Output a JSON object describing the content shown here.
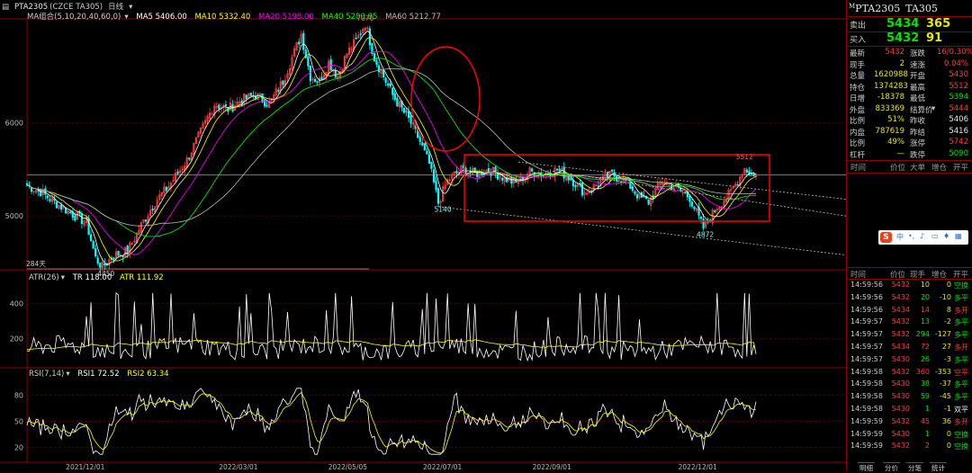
{
  "header": {
    "menu_icon": "menu-icon",
    "contract": "PTA2305",
    "exchange": "(CZCE TA305)",
    "period": "日线",
    "ma_title": "MA组合(5,10,20,40,60,0)",
    "ma5": "MA5 5406.00",
    "ma10": "MA10 5332.40",
    "ma20": "MA20 5198.00",
    "ma40": "MA40 5200.85",
    "ma60": "MA60 5212.77"
  },
  "colors": {
    "up": "#ff3c3c",
    "down": "#00ffff",
    "ma5": "#ffffff",
    "ma10": "#ffff00",
    "ma20": "#ff00ff",
    "ma40": "#00ff00",
    "ma60": "#bbbbbb",
    "annotation": "#ff0000"
  },
  "chart_data": [
    {
      "type": "candlestick",
      "name": "main",
      "y_ticks": [
        6000,
        5000
      ],
      "ylim": [
        4450,
        7070
      ],
      "labels": {
        "high": "7070",
        "low": "4450",
        "range_low": "5140",
        "range_high": "5512",
        "recent_low": "4872",
        "note": "284天"
      },
      "x_ticks": [
        "2021/12/01",
        "2022/03/01",
        "2022/05/05",
        "2022/07/01",
        "2022/09/01",
        "2022/12/01"
      ],
      "price_path": [
        [
          0,
          5330
        ],
        [
          6,
          5260
        ],
        [
          12,
          5150
        ],
        [
          20,
          5020
        ],
        [
          26,
          4930
        ],
        [
          30,
          4550
        ],
        [
          33,
          4450
        ],
        [
          38,
          4580
        ],
        [
          44,
          4620
        ],
        [
          50,
          4900
        ],
        [
          56,
          5150
        ],
        [
          62,
          5320
        ],
        [
          70,
          5600
        ],
        [
          76,
          5900
        ],
        [
          82,
          6200
        ],
        [
          88,
          6150
        ],
        [
          94,
          6250
        ],
        [
          100,
          6300
        ],
        [
          106,
          6200
        ],
        [
          112,
          6450
        ],
        [
          116,
          6700
        ],
        [
          120,
          6950
        ],
        [
          124,
          6500
        ],
        [
          128,
          6450
        ],
        [
          132,
          6650
        ],
        [
          136,
          6500
        ],
        [
          140,
          6750
        ],
        [
          144,
          6880
        ],
        [
          148,
          7070
        ],
        [
          152,
          6700
        ],
        [
          156,
          6500
        ],
        [
          160,
          6300
        ],
        [
          164,
          6150
        ],
        [
          168,
          6000
        ],
        [
          172,
          5800
        ],
        [
          176,
          5560
        ],
        [
          180,
          5140
        ],
        [
          184,
          5380
        ],
        [
          190,
          5500
        ],
        [
          196,
          5450
        ],
        [
          202,
          5500
        ],
        [
          208,
          5420
        ],
        [
          214,
          5350
        ],
        [
          220,
          5480
        ],
        [
          226,
          5450
        ],
        [
          232,
          5500
        ],
        [
          238,
          5400
        ],
        [
          244,
          5250
        ],
        [
          250,
          5350
        ],
        [
          256,
          5450
        ],
        [
          262,
          5380
        ],
        [
          268,
          5200
        ],
        [
          272,
          5150
        ],
        [
          278,
          5380
        ],
        [
          284,
          5300
        ],
        [
          290,
          5200
        ],
        [
          296,
          4872
        ],
        [
          302,
          5100
        ],
        [
          308,
          5250
        ],
        [
          314,
          5512
        ],
        [
          318,
          5432
        ]
      ],
      "total_bars": 320
    },
    {
      "type": "line",
      "name": "ATR",
      "params": "ATR(26)",
      "series": [
        {
          "name": "TR",
          "last": 118.0
        },
        {
          "name": "ATR",
          "last": 111.92
        }
      ],
      "y_ticks": [
        400,
        200
      ]
    },
    {
      "type": "line",
      "name": "RSI",
      "params": "RSI(7,14)",
      "series": [
        {
          "name": "RSI1",
          "last": 72.52
        },
        {
          "name": "RSI2",
          "last": 63.34
        }
      ],
      "y_ticks": [
        80,
        50,
        20
      ]
    }
  ],
  "indicators": {
    "atr_title": "ATR(26)",
    "atr_tr": "TR 118.00",
    "atr_atr": "ATR 111.92",
    "rsi_title": "RSI(7,14)",
    "rsi1": "RSI1 72.52",
    "rsi2": "RSI2 63.34"
  },
  "axis": {
    "y_main": [
      "6000",
      "5000"
    ],
    "y_atr": [
      "400",
      "200"
    ],
    "y_rsi": [
      "80",
      "50",
      "20"
    ],
    "x": [
      "2021/12/01",
      "2022/03/01",
      "2022/05/05",
      "2022/07/01",
      "2022/09/01",
      "2022/12/01"
    ]
  },
  "panel": {
    "code": "PTA2305",
    "exchange_code": "TA305",
    "sell_label": "卖出",
    "sell_price": "5434",
    "sell_vol": "365",
    "buy_label": "买入",
    "buy_price": "5432",
    "buy_vol": "91",
    "quote": [
      {
        "l1": "最新",
        "v1": "5432",
        "c1": "#ff3c3c",
        "l2": "涨跌",
        "v2": "16/0.30%",
        "c2": "#ff3c3c"
      },
      {
        "l1": "现手",
        "v1": "2",
        "c1": "#e8e800",
        "l2": "速涨",
        "v2": "0.04%",
        "c2": "#ff3c3c"
      },
      {
        "l1": "总量",
        "v1": "1620988",
        "c1": "#e8e800",
        "l2": "开盘",
        "v2": "5430",
        "c2": "#ff3c3c"
      },
      {
        "l1": "持仓",
        "v1": "1374283",
        "c1": "#e8e800",
        "l2": "最高",
        "v2": "5512",
        "c2": "#ff3c3c"
      },
      {
        "l1": "日增",
        "v1": "-18378",
        "c1": "#e8e800",
        "l2": "最低",
        "v2": "5394",
        "c2": "#00e400"
      },
      {
        "l1": "外盘",
        "v1": "833369",
        "c1": "#e8e800",
        "l2": "结算价",
        "v2": "5444",
        "c2": "#ff3c3c"
      },
      {
        "l1": "比例",
        "v1": "51%",
        "c1": "#e8e800",
        "l2": "昨收",
        "v2": "5406",
        "c2": "#e8e8e8"
      },
      {
        "l1": "内盘",
        "v1": "787619",
        "c1": "#e8e800",
        "l2": "昨结",
        "v2": "5416",
        "c2": "#e8e8e8"
      },
      {
        "l1": "比例",
        "v1": "49%",
        "c1": "#e8e800",
        "l2": "涨停",
        "v2": "5742",
        "c2": "#ff3c3c"
      },
      {
        "l1": "杠杆",
        "v1": "—",
        "c1": "#e8e800",
        "l2": "跌停",
        "v2": "5090",
        "c2": "#00e400"
      }
    ],
    "col_headers_1": [
      "时间",
      "价位",
      "大单",
      "增仓",
      "开平"
    ],
    "col_headers_2": [
      "时间",
      "价位",
      "现手",
      "增仓",
      "开平"
    ],
    "ticks": [
      {
        "time": "14:59:56",
        "price": "5432",
        "vol": "10",
        "oi": "0",
        "nature": "空换",
        "vc": "#e8e800",
        "oc": "#e8e800",
        "nc": "#00e400"
      },
      {
        "time": "14:59:56",
        "price": "5432",
        "vol": "20",
        "oi": "-10",
        "nature": "多平",
        "vc": "#00e400",
        "oc": "#e8e800",
        "nc": "#00e400"
      },
      {
        "time": "14:59:56",
        "price": "5434",
        "vol": "14",
        "oi": "8",
        "nature": "多开",
        "vc": "#ff3c3c",
        "oc": "#e8e800",
        "nc": "#ff3c3c"
      },
      {
        "time": "14:59:57",
        "price": "5432",
        "vol": "13",
        "oi": "-2",
        "nature": "多平",
        "vc": "#00e400",
        "oc": "#e8e800",
        "nc": "#00e400"
      },
      {
        "time": "14:59:57",
        "price": "5432",
        "vol": "294",
        "oi": "-127",
        "nature": "多平",
        "vc": "#00e400",
        "oc": "#e8e800",
        "nc": "#00e400"
      },
      {
        "time": "14:59:57",
        "price": "5434",
        "vol": "72",
        "oi": "27",
        "nature": "多开",
        "vc": "#ff3c3c",
        "oc": "#e8e800",
        "nc": "#ff3c3c"
      },
      {
        "time": "14:59:57",
        "price": "5430",
        "vol": "26",
        "oi": "-3",
        "nature": "多平",
        "vc": "#00e400",
        "oc": "#e8e800",
        "nc": "#00e400"
      },
      {
        "time": "14:59:58",
        "price": "5432",
        "vol": "360",
        "oi": "-353",
        "nature": "空平",
        "vc": "#ff3c3c",
        "oc": "#e8e800",
        "nc": "#ff3c3c"
      },
      {
        "time": "14:59:58",
        "price": "5430",
        "vol": "38",
        "oi": "-37",
        "nature": "多平",
        "vc": "#00e400",
        "oc": "#e8e800",
        "nc": "#00e400"
      },
      {
        "time": "14:59:58",
        "price": "5430",
        "vol": "59",
        "oi": "-45",
        "nature": "多平",
        "vc": "#00e400",
        "oc": "#e8e800",
        "nc": "#00e400"
      },
      {
        "time": "14:59:58",
        "price": "5430",
        "vol": "1",
        "oi": "-1",
        "nature": "双平",
        "vc": "#00e400",
        "oc": "#e8e800",
        "nc": "#e8e8e8"
      },
      {
        "time": "14:59:59",
        "price": "5432",
        "vol": "45",
        "oi": "36",
        "nature": "多开",
        "vc": "#ff3c3c",
        "oc": "#e8e800",
        "nc": "#ff3c3c"
      },
      {
        "time": "14:59:59",
        "price": "5430",
        "vol": "1",
        "oi": "0",
        "nature": "空换",
        "vc": "#00e400",
        "oc": "#e8e800",
        "nc": "#00e400"
      },
      {
        "time": "14:59:59",
        "price": "5432",
        "vol": "2",
        "oi": "0",
        "nature": "空换",
        "vc": "#ff3c3c",
        "oc": "#e8e800",
        "nc": "#00e400"
      }
    ],
    "tabs": [
      "明细",
      "分价",
      "分笔",
      "统计"
    ]
  }
}
